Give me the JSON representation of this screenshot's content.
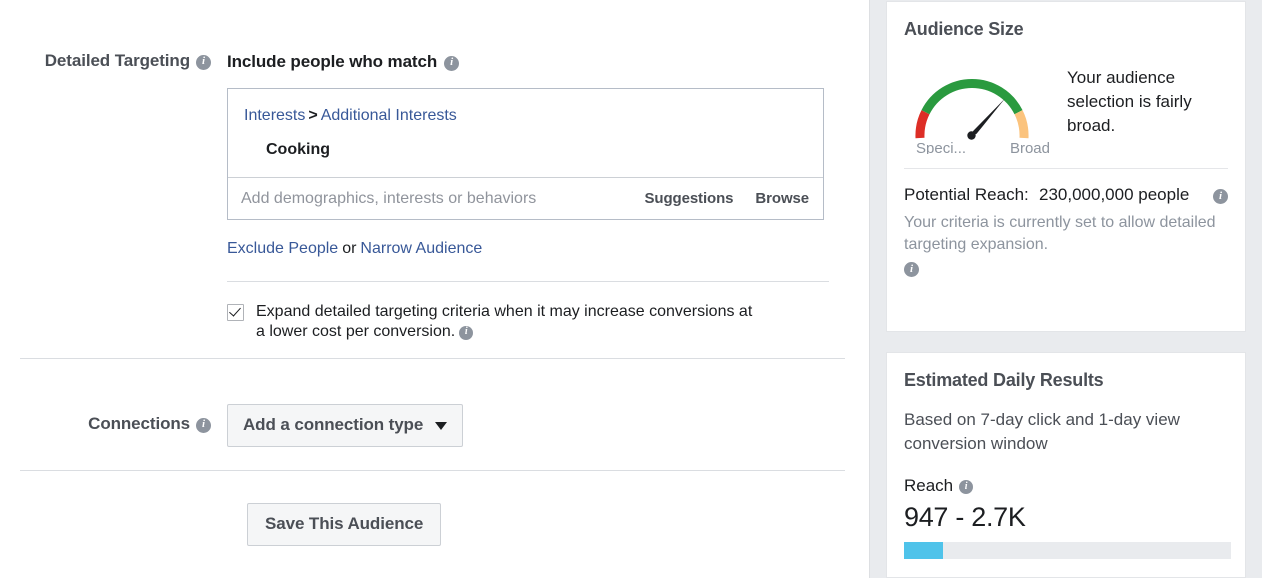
{
  "left": {
    "detailed_targeting": {
      "label": "Detailed Targeting",
      "info_icon": "info-icon",
      "include_heading": "Include people who match",
      "include_info_icon": "info-icon",
      "breadcrumb": {
        "root": "Interests",
        "separator": ">",
        "child": "Additional Interests"
      },
      "selected_item": "Cooking",
      "input_placeholder": "Add demographics, interests or behaviors",
      "input_value": "",
      "suggestions_label": "Suggestions",
      "browse_label": "Browse",
      "exclude_label": "Exclude People",
      "conjunction": "or",
      "narrow_label": "Narrow Audience",
      "expand_checkbox_checked": true,
      "expand_text": "Expand detailed targeting criteria when it may increase conversions at a lower cost per conversion.",
      "expand_info_icon": "info-icon"
    },
    "connections": {
      "label": "Connections",
      "info_icon": "info-icon",
      "button_label": "Add a connection type",
      "caret_icon": "chevron-down-icon"
    },
    "save_button_label": "Save This Audience"
  },
  "right": {
    "audience_size": {
      "title": "Audience Size",
      "gauge": {
        "specific_label": "Speci...",
        "broad_label": "Broad",
        "needle_angle_deg": 48,
        "colors": {
          "specific": "#dd2e26",
          "mid": "#2a9a3f",
          "broad": "#fbc37d"
        }
      },
      "description": "Your audience selection is fairly broad.",
      "potential_reach_label": "Potential Reach:",
      "potential_reach_value": "230,000,000 people",
      "potential_reach_info_icon": "info-icon",
      "criteria_note": "Your criteria is currently set to allow detailed targeting expansion.",
      "criteria_note_info_icon": "info-icon"
    },
    "estimated_daily_results": {
      "title": "Estimated Daily Results",
      "subtitle": "Based on 7-day click and 1-day view conversion window",
      "reach_label": "Reach",
      "reach_info_icon": "info-icon",
      "reach_value": "947 - 2.7K",
      "progress_percent": 12,
      "progress_color": "#4fc3ea"
    }
  }
}
